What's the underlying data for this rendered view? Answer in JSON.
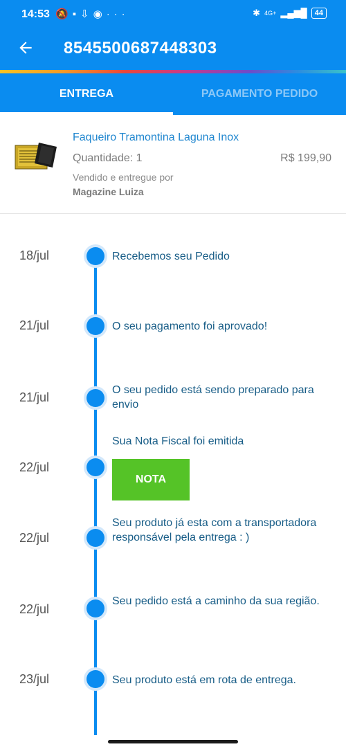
{
  "status_bar": {
    "time": "14:53",
    "network": "4G+",
    "battery": "44"
  },
  "header": {
    "title": "8545500687448303"
  },
  "tabs": [
    {
      "label": "ENTREGA",
      "active": true
    },
    {
      "label": "PAGAMENTO PEDIDO",
      "active": false
    }
  ],
  "product": {
    "name": "Faqueiro Tramontina Laguna Inox",
    "quantity": "Quantidade: 1",
    "price": "R$ 199,90",
    "sold_by_label": "Vendido e entregue por",
    "seller": "Magazine Luiza"
  },
  "timeline": [
    {
      "date": "18/jul",
      "text": "Recebemos seu Pedido"
    },
    {
      "date": "21/jul",
      "text": "O seu pagamento foi aprovado!"
    },
    {
      "date": "21/jul",
      "text": "O seu pedido está sendo preparado para envio"
    },
    {
      "date": "22/jul",
      "text": "Sua Nota Fiscal foi emitida",
      "button": "NOTA"
    },
    {
      "date": "22/jul",
      "text": "Seu produto já esta com a transportadora responsável pela entrega : )"
    },
    {
      "date": "22/jul",
      "text": "Seu pedido está a caminho da sua região."
    },
    {
      "date": "23/jul",
      "text": "Seu produto está em rota de entrega."
    }
  ],
  "colors": {
    "primary": "#0a8cf0",
    "button_green": "#55c327",
    "link_text": "#1f86cf"
  }
}
